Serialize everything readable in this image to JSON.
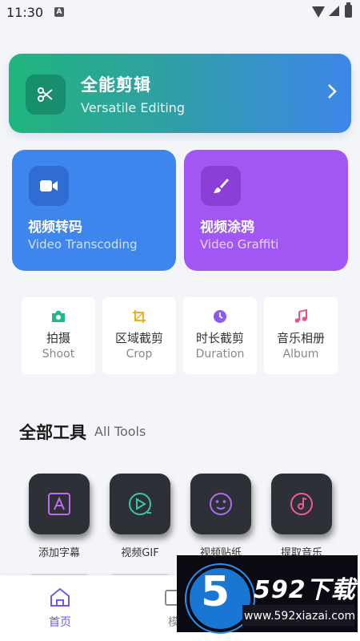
{
  "status_bar": {
    "time": "11:30",
    "app_icon_letter": "A"
  },
  "hero": {
    "title": "全能剪辑",
    "subtitle": "Versatile Editing",
    "icon": "scissors-icon"
  },
  "cards": [
    {
      "title": "视频转码",
      "subtitle": "Video Transcoding",
      "icon": "video-camera-icon",
      "color": "#3e86ee"
    },
    {
      "title": "视频涂鸦",
      "subtitle": "Video Graffiti",
      "icon": "brush-icon",
      "color": "#a257f5"
    }
  ],
  "quick_tools": [
    {
      "zh": "拍摄",
      "en": "Shoot",
      "icon": "camera-icon",
      "color": "#1fb98a"
    },
    {
      "zh": "区域截剪",
      "en": "Crop",
      "icon": "crop-icon",
      "color": "#f2b01e"
    },
    {
      "zh": "时长截剪",
      "en": "Duration",
      "icon": "clock-icon",
      "color": "#8a5cf0"
    },
    {
      "zh": "音乐相册",
      "en": "Album",
      "icon": "music-note-icon",
      "color": "#ef4f8a"
    }
  ],
  "section": {
    "title": "全部工具",
    "subtitle": "All Tools"
  },
  "tools": [
    {
      "label": "添加字幕",
      "icon": "subtitle-icon",
      "color": "#c06af0"
    },
    {
      "label": "视频GIF",
      "icon": "play-circle-icon",
      "color": "#36c7a5"
    },
    {
      "label": "视频贴纸",
      "icon": "smiley-icon",
      "color": "#b06af0"
    },
    {
      "label": "提取音乐",
      "icon": "music-disc-icon",
      "color": "#ef5a9a"
    }
  ],
  "bottom_nav": {
    "home_label": "首页",
    "second_label": "模"
  },
  "watermark": {
    "digit": "5",
    "brand": "592下载",
    "url": "www.592xiazai.com"
  },
  "colors": {
    "accent": "#6a5cf0",
    "hero_start": "#21b57e",
    "hero_end": "#3d86ea"
  }
}
